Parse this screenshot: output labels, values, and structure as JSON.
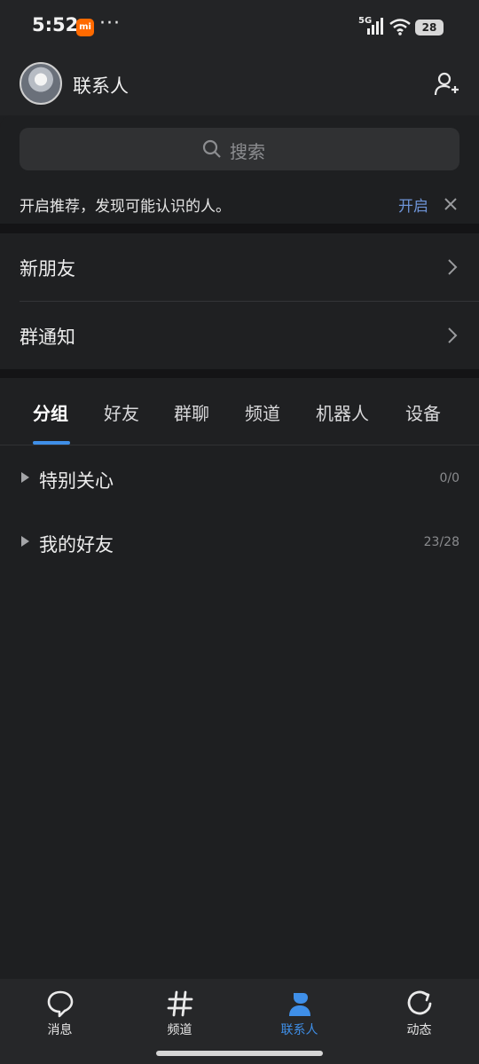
{
  "status_bar": {
    "time": "5:52",
    "app_badge": "mi",
    "more": "···",
    "network": "5G",
    "battery": "28"
  },
  "header": {
    "title": "联系人",
    "avatar_icon": "avatar",
    "add_icon": "add-friend-icon"
  },
  "search": {
    "placeholder": "搜索"
  },
  "recommend": {
    "text": "开启推荐，发现可能认识的人。",
    "action": "开启"
  },
  "entries": [
    {
      "label": "新朋友"
    },
    {
      "label": "群通知"
    }
  ],
  "tabs": [
    {
      "label": "分组",
      "active": true
    },
    {
      "label": "好友"
    },
    {
      "label": "群聊"
    },
    {
      "label": "频道"
    },
    {
      "label": "机器人"
    },
    {
      "label": "设备"
    }
  ],
  "groups": [
    {
      "name": "特别关心",
      "count": "0/0"
    },
    {
      "name": "我的好友",
      "count": "23/28"
    }
  ],
  "bottom_nav": [
    {
      "label": "消息",
      "icon": "message-icon"
    },
    {
      "label": "频道",
      "icon": "channel-icon"
    },
    {
      "label": "联系人",
      "icon": "contacts-icon",
      "active": true
    },
    {
      "label": "动态",
      "icon": "moments-icon"
    }
  ],
  "colors": {
    "accent": "#3f8fe8",
    "link": "#6d93d6",
    "background": "#1e1f21"
  }
}
